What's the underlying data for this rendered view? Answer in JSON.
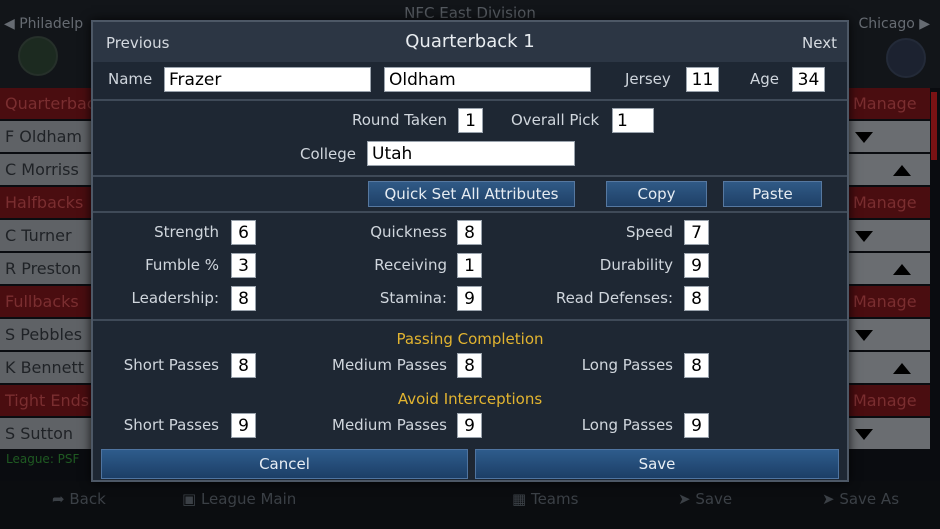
{
  "background": {
    "title": "NFC East Division",
    "team_left": "Philadelp",
    "team_right": "Chicago",
    "left_rows": [
      {
        "text": "Quarterbac",
        "kind": "group"
      },
      {
        "text": "F Oldham",
        "kind": "player"
      },
      {
        "text": "C Morriss",
        "kind": "player"
      },
      {
        "text": "Halfbacks",
        "kind": "group"
      },
      {
        "text": "C Turner",
        "kind": "player"
      },
      {
        "text": "R Preston",
        "kind": "player"
      },
      {
        "text": "Fullbacks",
        "kind": "group"
      },
      {
        "text": "S Pebbles",
        "kind": "player"
      },
      {
        "text": "K Bennett",
        "kind": "player"
      },
      {
        "text": "Tight Ends",
        "kind": "group"
      },
      {
        "text": "S Sutton",
        "kind": "player"
      }
    ],
    "right_rows": [
      {
        "text": "Manage",
        "kind": "group"
      },
      {
        "text": "",
        "kind": "player",
        "arrow": "down"
      },
      {
        "text": "",
        "kind": "player",
        "arrow": "up"
      },
      {
        "text": "Manage",
        "kind": "group"
      },
      {
        "text": "",
        "kind": "player",
        "arrow": "down"
      },
      {
        "text": "",
        "kind": "player",
        "arrow": "up"
      },
      {
        "text": "Manage",
        "kind": "group"
      },
      {
        "text": "",
        "kind": "player",
        "arrow": "down"
      },
      {
        "text": "",
        "kind": "player",
        "arrow": "up"
      },
      {
        "text": "Manage",
        "kind": "group"
      },
      {
        "text": "",
        "kind": "player",
        "arrow": "down"
      }
    ],
    "status": "League: PSF",
    "footer": {
      "back": "Back",
      "league_main": "League Main",
      "teams": "Teams",
      "save": "Save",
      "save_as": "Save As"
    }
  },
  "modal": {
    "title": "Quarterback 1",
    "previous_label": "Previous",
    "next_label": "Next",
    "name_label": "Name",
    "first_name": "Frazer",
    "last_name": "Oldham",
    "jersey_label": "Jersey",
    "jersey": "11",
    "age_label": "Age",
    "age": "34",
    "round_label": "Round Taken",
    "round": "1",
    "overall_label": "Overall Pick",
    "overall": "1",
    "college_label": "College",
    "college": "Utah",
    "quick_set_label": "Quick Set All Attributes",
    "copy_label": "Copy",
    "paste_label": "Paste",
    "attributes": {
      "strength_label": "Strength",
      "strength": "6",
      "quickness_label": "Quickness",
      "quickness": "8",
      "speed_label": "Speed",
      "speed": "7",
      "fumble_label": "Fumble %",
      "fumble": "3",
      "receiving_label": "Receiving",
      "receiving": "1",
      "durability_label": "Durability",
      "durability": "9",
      "leadership_label": "Leadership:",
      "leadership": "8",
      "stamina_label": "Stamina:",
      "stamina": "9",
      "read_def_label": "Read Defenses:",
      "read_def": "8"
    },
    "passing": {
      "title": "Passing Completion",
      "short_label": "Short Passes",
      "short": "8",
      "medium_label": "Medium Passes",
      "medium": "8",
      "long_label": "Long Passes",
      "long": "8"
    },
    "interceptions": {
      "title": "Avoid Interceptions",
      "short_label": "Short Passes",
      "short": "9",
      "medium_label": "Medium Passes",
      "medium": "9",
      "long_label": "Long Passes",
      "long": "9"
    },
    "cancel_label": "Cancel",
    "save_label": "Save"
  }
}
